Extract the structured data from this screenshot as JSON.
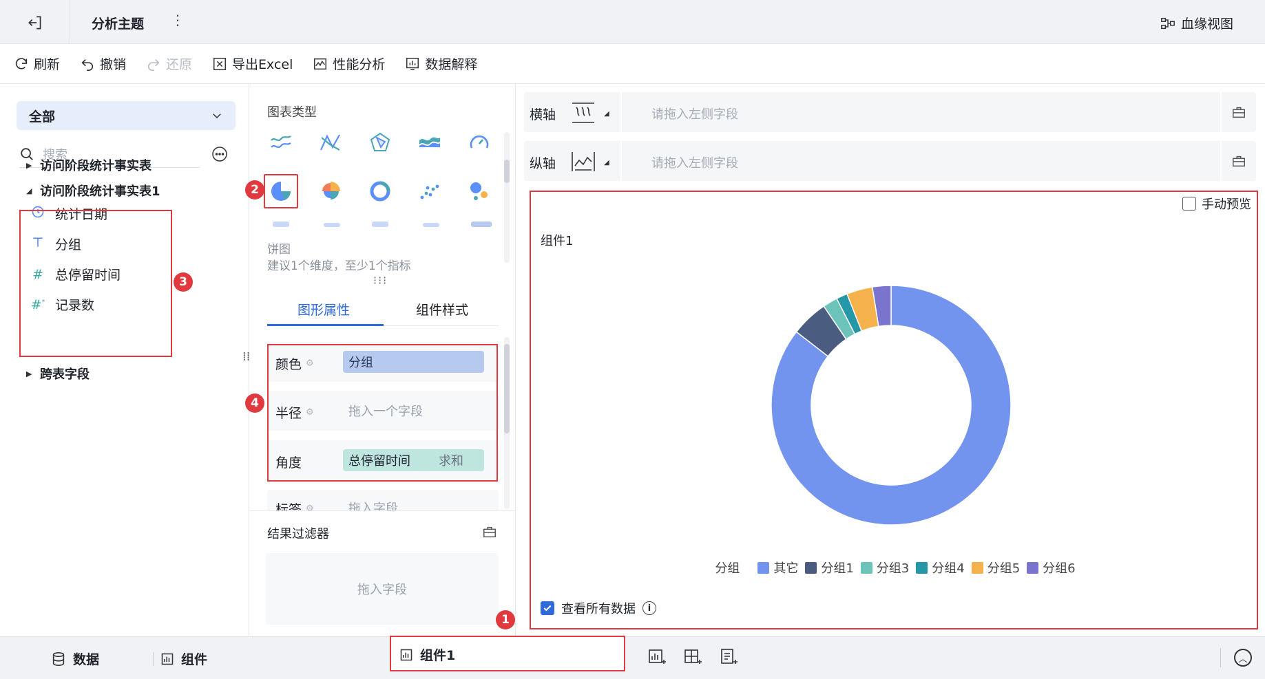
{
  "topbar": {
    "title": "分析主题",
    "more_label": "⋮",
    "lineage_label": "血缘视图"
  },
  "toolbar": {
    "refresh": "刷新",
    "undo": "撤销",
    "redo": "还原",
    "export": "导出Excel",
    "perf": "性能分析",
    "explain": "数据解释"
  },
  "left": {
    "filter_label": "全部",
    "search_placeholder": "搜索",
    "tables": [
      {
        "label": "访问阶段统计事实表",
        "expanded": false
      },
      {
        "label": "访问阶段统计事实表1",
        "expanded": true
      },
      {
        "label": "跨表字段",
        "expanded": false
      }
    ],
    "fields": [
      {
        "icon": "clock-icon",
        "label": "统计日期"
      },
      {
        "icon": "text-type-icon",
        "label": "分组"
      },
      {
        "icon": "number-type-icon",
        "label": "总停留时间"
      },
      {
        "icon": "number-count-icon",
        "label": "记录数"
      }
    ]
  },
  "middle": {
    "chart_type_label": "图表类型",
    "selected_chart_name": "饼图",
    "selected_chart_hint": "建议1个维度，至少1个指标",
    "tabs": [
      "图形属性",
      "组件样式"
    ],
    "props": [
      {
        "label": "颜色",
        "value": "分组",
        "agg": ""
      },
      {
        "label": "半径",
        "value": "拖入一个字段",
        "agg": ""
      },
      {
        "label": "角度",
        "value": "总停留时间",
        "agg": "求和"
      },
      {
        "label": "标签",
        "value": "拖入字段",
        "agg": ""
      }
    ],
    "filter_title": "结果过滤器",
    "filter_placeholder": "拖入字段"
  },
  "right": {
    "x_axis_label": "横轴",
    "y_axis_label": "纵轴",
    "axis_placeholder": "请拖入左侧字段",
    "manual_preview": "手动预览",
    "component_title": "组件1",
    "view_all": "查看所有数据",
    "legend_title": "分组"
  },
  "chart_data": {
    "type": "pie",
    "donut": true,
    "title": "组件1",
    "categories": [
      "其它",
      "分组1",
      "分组3",
      "分组4",
      "分组5",
      "分组6"
    ],
    "values": [
      85.5,
      5.0,
      2.0,
      1.5,
      3.5,
      2.5
    ],
    "colors": [
      "#7394ee",
      "#4a5c80",
      "#6cc3b9",
      "#2697a8",
      "#f5b14b",
      "#7b74cf"
    ],
    "legend_title": "分组",
    "legend_position": "bottom"
  },
  "bottombar": {
    "data_label": "数据",
    "component_label": "组件",
    "active_tab": "组件1"
  },
  "annotations": [
    "1",
    "2",
    "3",
    "4"
  ]
}
